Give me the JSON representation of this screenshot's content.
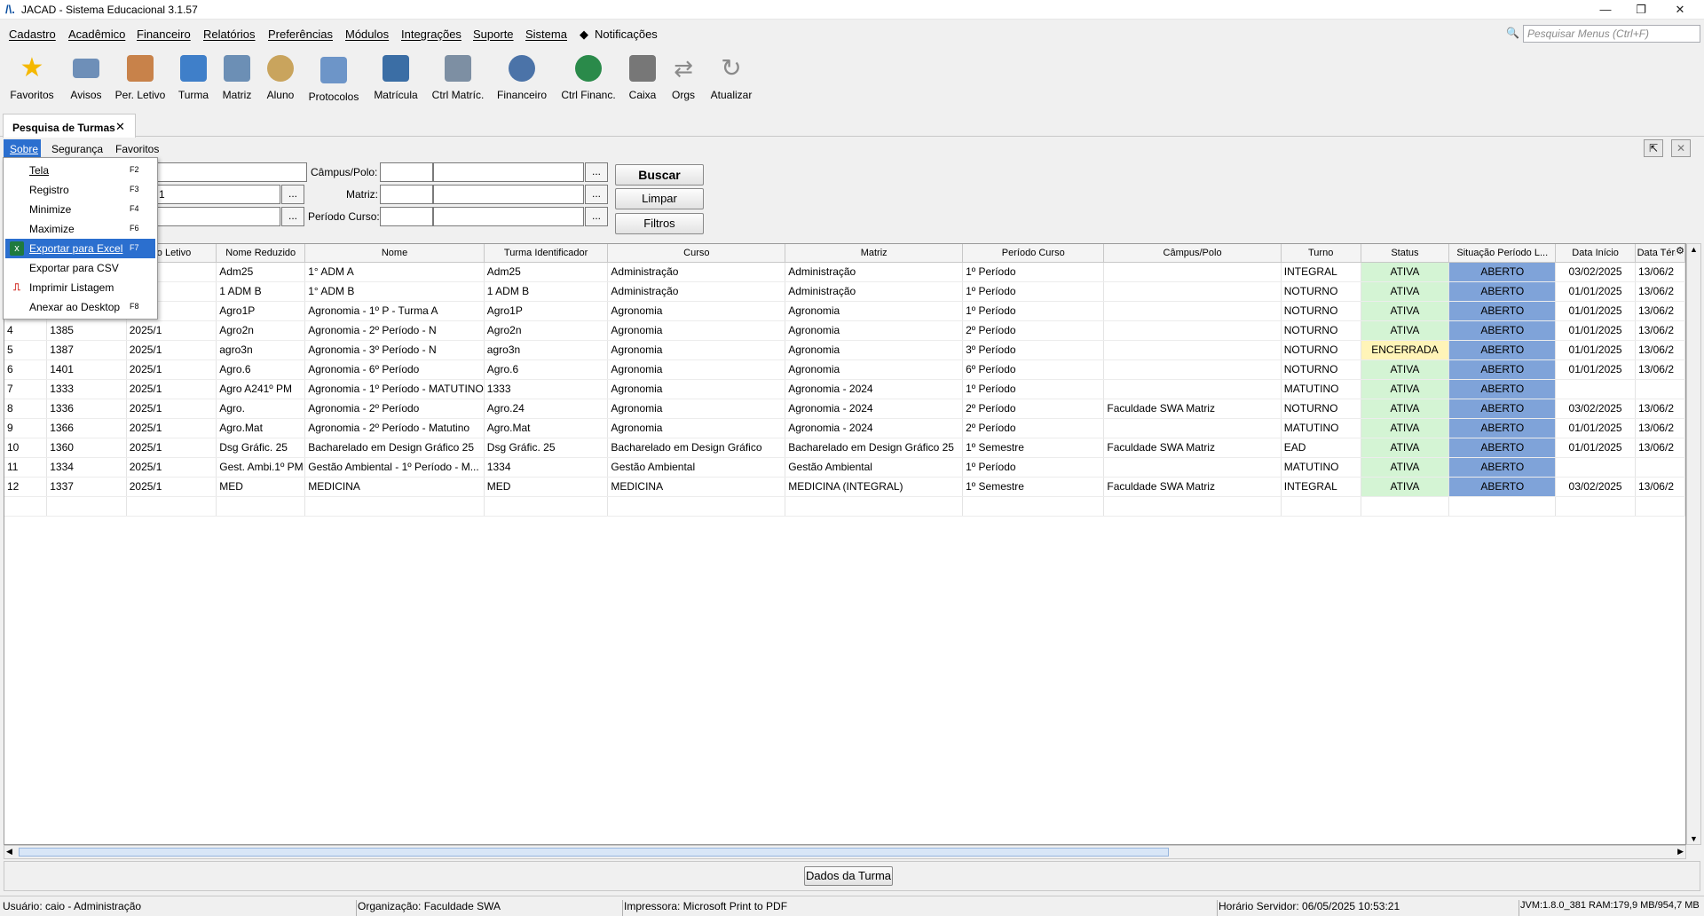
{
  "window": {
    "title": "JACAD - Sistema Educacional 3.1.57",
    "logo": "/\\.",
    "minimize": "—",
    "restore": "❐",
    "close": "✕"
  },
  "menu": [
    "Cadastro",
    "Acadêmico",
    "Financeiro",
    "Relatórios",
    "Preferências",
    "Módulos",
    "Integrações",
    "Suporte",
    "Sistema",
    "Notificações"
  ],
  "search": {
    "placeholder": "Pesquisar Menus (Ctrl+F)"
  },
  "toolbar": [
    {
      "label": "Favoritos",
      "icon": "star-icon",
      "color": "#f5b800"
    },
    {
      "label": "Avisos",
      "icon": "envelope-icon",
      "color": "#6e8fb8"
    },
    {
      "label": "Per. Letivo",
      "icon": "calendar-icon",
      "color": "#c8824a"
    },
    {
      "label": "Turma",
      "icon": "group-icon",
      "color": "#3f7fc9"
    },
    {
      "label": "Matriz",
      "icon": "document-icon",
      "color": "#6c8fb5"
    },
    {
      "label": "Aluno",
      "icon": "student-icon",
      "color": "#c9a45d"
    },
    {
      "label": "Protocolos",
      "icon": "protocol-icon",
      "color": "#6d95c8"
    },
    {
      "label": "Matrícula",
      "icon": "enrollment-icon",
      "color": "#3b6ea5"
    },
    {
      "label": "Ctrl Matríc.",
      "icon": "search-doc-icon",
      "color": "#7d8fa3"
    },
    {
      "label": "Financeiro",
      "icon": "finance-person-icon",
      "color": "#4b73a8"
    },
    {
      "label": "Ctrl Financ.",
      "icon": "money-hand-icon",
      "color": "#2a8a4a"
    },
    {
      "label": "Caixa",
      "icon": "cash-register-icon",
      "color": "#777777"
    },
    {
      "label": "Orgs",
      "icon": "arrows-icon",
      "color": "#8a8a8a"
    },
    {
      "label": "Atualizar",
      "icon": "refresh-icon",
      "color": "#8a8a8a"
    }
  ],
  "tab": {
    "label": "Pesquisa de Turmas",
    "close": "✕"
  },
  "submenu": [
    "Sobre",
    "Segurança",
    "Favoritos"
  ],
  "filters": {
    "campus_label": "Câmpus/Polo:",
    "matriz_label": "Matriz:",
    "periodo_label": "Período Curso:",
    "partial_value": "1",
    "dots": "..."
  },
  "buttons": {
    "buscar": "Buscar",
    "limpar": "Limpar",
    "filtros": "Filtros",
    "dados": "Dados da Turma"
  },
  "dropdown": [
    {
      "label": "Tela",
      "key": "F2",
      "icon": ""
    },
    {
      "label": "Registro",
      "key": "F3",
      "icon": ""
    },
    {
      "label": "Minimize",
      "key": "F4",
      "icon": ""
    },
    {
      "label": "Maximize",
      "key": "F6",
      "icon": ""
    },
    {
      "label": "Exportar para Excel",
      "key": "F7",
      "icon": "excel-icon"
    },
    {
      "label": "Exportar para CSV",
      "key": "",
      "icon": ""
    },
    {
      "label": "Imprimir Listagem",
      "key": "",
      "icon": "pdf-icon"
    },
    {
      "label": "Anexar ao Desktop",
      "key": "F8",
      "icon": ""
    }
  ],
  "table": {
    "columns": [
      "",
      "",
      "do Letivo",
      "Nome Reduzido",
      "Nome",
      "Turma Identificador",
      "Curso",
      "Matriz",
      "Período Curso",
      "Câmpus/Polo",
      "Turno",
      "Status",
      "Situação Período L...",
      "Data Início",
      "Data Térm"
    ],
    "rows": [
      [
        "",
        "",
        "",
        "Adm25",
        "1° ADM A",
        "Adm25",
        "Administração",
        "Administração",
        "1º Período",
        "",
        "INTEGRAL",
        "ATIVA",
        "ABERTO",
        "03/02/2025",
        "13/06/2"
      ],
      [
        "",
        "",
        "",
        "1 ADM B",
        "1° ADM B",
        "1 ADM B",
        "Administração",
        "Administração",
        "1º Período",
        "",
        "NOTURNO",
        "ATIVA",
        "ABERTO",
        "01/01/2025",
        "13/06/2"
      ],
      [
        "",
        "",
        "",
        "Agro1P",
        "Agronomia - 1º P - Turma A",
        "Agro1P",
        "Agronomia",
        "Agronomia",
        "1º Período",
        "",
        "NOTURNO",
        "ATIVA",
        "ABERTO",
        "01/01/2025",
        "13/06/2"
      ],
      [
        "4",
        "1385",
        "2025/1",
        "Agro2n",
        "Agronomia - 2º Período - N",
        "Agro2n",
        "Agronomia",
        "Agronomia",
        "2º Período",
        "",
        "NOTURNO",
        "ATIVA",
        "ABERTO",
        "01/01/2025",
        "13/06/2"
      ],
      [
        "5",
        "1387",
        "2025/1",
        "agro3n",
        "Agronomia - 3º Período - N",
        "agro3n",
        "Agronomia",
        "Agronomia",
        "3º Período",
        "",
        "NOTURNO",
        "ENCERRADA",
        "ABERTO",
        "01/01/2025",
        "13/06/2"
      ],
      [
        "6",
        "1401",
        "2025/1",
        "Agro.6",
        "Agronomia - 6º Período",
        "Agro.6",
        "Agronomia",
        "Agronomia",
        "6º Período",
        "",
        "NOTURNO",
        "ATIVA",
        "ABERTO",
        "01/01/2025",
        "13/06/2"
      ],
      [
        "7",
        "1333",
        "2025/1",
        "Agro A241º PM",
        "Agronomia - 1º Período - MATUTINO",
        "1333",
        "Agronomia",
        "Agronomia - 2024",
        "1º Período",
        "",
        "MATUTINO",
        "ATIVA",
        "ABERTO",
        "",
        ""
      ],
      [
        "8",
        "1336",
        "2025/1",
        "Agro.",
        "Agronomia - 2º Período",
        "Agro.24",
        "Agronomia",
        "Agronomia - 2024",
        "2º Período",
        "Faculdade SWA Matriz",
        "NOTURNO",
        "ATIVA",
        "ABERTO",
        "03/02/2025",
        "13/06/2"
      ],
      [
        "9",
        "1366",
        "2025/1",
        "Agro.Mat",
        "Agronomia - 2º Período - Matutino",
        "Agro.Mat",
        "Agronomia",
        "Agronomia - 2024",
        "2º Período",
        "",
        "MATUTINO",
        "ATIVA",
        "ABERTO",
        "01/01/2025",
        "13/06/2"
      ],
      [
        "10",
        "1360",
        "2025/1",
        "Dsg Gráfic. 25",
        "Bacharelado em Design Gráfico 25",
        "Dsg Gráfic. 25",
        "Bacharelado em Design Gráfico",
        "Bacharelado em Design Gráfico 25",
        "1º Semestre",
        "Faculdade SWA Matriz",
        "EAD",
        "ATIVA",
        "ABERTO",
        "01/01/2025",
        "13/06/2"
      ],
      [
        "11",
        "1334",
        "2025/1",
        "Gest. Ambi.1º PM",
        "Gestão Ambiental - 1º Período - M...",
        "1334",
        "Gestão Ambiental",
        "Gestão Ambiental",
        "1º Período",
        "",
        "MATUTINO",
        "ATIVA",
        "ABERTO",
        "",
        ""
      ],
      [
        "12",
        "1337",
        "2025/1",
        "MED",
        "MEDICINA",
        "MED",
        "MEDICINA",
        "MEDICINA (INTEGRAL)",
        "1º Semestre",
        "Faculdade SWA Matriz",
        "INTEGRAL",
        "ATIVA",
        "ABERTO",
        "03/02/2025",
        "13/06/2"
      ]
    ]
  },
  "status": {
    "usuario": "Usuário: caio - Administração",
    "organizacao": "Organização: Faculdade SWA",
    "impressora": "Impressora: Microsoft Print to PDF",
    "horario": "Horário Servidor: 06/05/2025 10:53:21",
    "jvm": "JVM:1.8.0_381  RAM:179,9 MB/954,7 MB"
  },
  "colors": {
    "accent": "#2b6fcf",
    "ativa": "#d4f4d4",
    "encerrada": "#fff4b8",
    "aberto": "#7fa3d9"
  }
}
